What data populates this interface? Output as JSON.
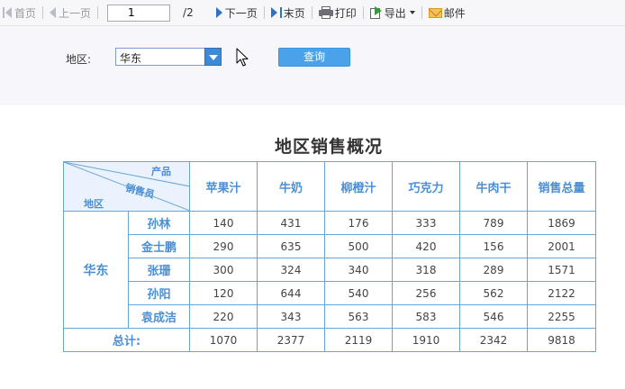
{
  "toolbar": {
    "first_page": "首页",
    "prev_page": "上一页",
    "page_number": "1",
    "page_total": "/2",
    "next_page": "下一页",
    "last_page": "末页",
    "print": "打印",
    "export": "导出",
    "mail": "邮件"
  },
  "query": {
    "region_label": "地区:",
    "region_value": "华东",
    "query_button": "查询"
  },
  "report": {
    "title": "地区销售概况",
    "corner": {
      "product": "产品",
      "salesperson": "销售员",
      "region": "地区"
    },
    "columns": [
      "苹果汁",
      "牛奶",
      "柳橙汁",
      "巧克力",
      "牛肉干",
      "销售总量"
    ],
    "region": "华东",
    "rows": [
      {
        "name": "孙林",
        "values": [
          "140",
          "431",
          "176",
          "333",
          "789",
          "1869"
        ]
      },
      {
        "name": "金士鹏",
        "values": [
          "290",
          "635",
          "500",
          "420",
          "156",
          "2001"
        ]
      },
      {
        "name": "张珊",
        "values": [
          "300",
          "324",
          "340",
          "318",
          "289",
          "1571"
        ]
      },
      {
        "name": "孙阳",
        "values": [
          "120",
          "644",
          "540",
          "256",
          "562",
          "2122"
        ]
      },
      {
        "name": "袁成洁",
        "values": [
          "220",
          "343",
          "563",
          "583",
          "546",
          "2255"
        ]
      }
    ],
    "total_label": "总计:",
    "totals": [
      "1070",
      "2377",
      "2119",
      "1910",
      "2342",
      "9818"
    ]
  }
}
